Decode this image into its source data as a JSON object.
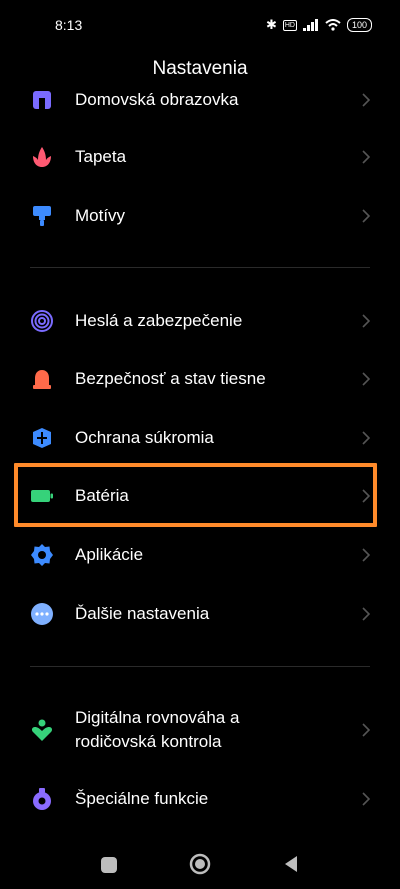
{
  "status": {
    "time": "8:13",
    "battery": "100",
    "network": "HD"
  },
  "page": {
    "title": "Nastavenia"
  },
  "items": [
    {
      "label": "Domovská obrazovka",
      "icon": "home-screen-icon",
      "color": "#7a6bff"
    },
    {
      "label": "Tapeta",
      "icon": "wallpaper-flower-icon",
      "color": "#ff5a73"
    },
    {
      "label": "Motívy",
      "icon": "themes-brush-icon",
      "color": "#3d8bff"
    },
    {
      "label": "Heslá a zabezpečenie",
      "icon": "fingerprint-icon",
      "color": "#7a6bff"
    },
    {
      "label": "Bezpečnosť a stav tiesne",
      "icon": "emergency-siren-icon",
      "color": "#ff6a4a"
    },
    {
      "label": "Ochrana súkromia",
      "icon": "privacy-shield-icon",
      "color": "#3d8bff"
    },
    {
      "label": "Batéria",
      "icon": "battery-icon",
      "color": "#36d27a"
    },
    {
      "label": "Aplikácie",
      "icon": "apps-gear-icon",
      "color": "#3d8bff"
    },
    {
      "label": "Ďalšie nastavenia",
      "icon": "more-dots-icon",
      "color": "#7fb0ff"
    },
    {
      "label": "Digitálna rovnováha a rodičovská kontrola",
      "icon": "digital-wellbeing-icon",
      "color": "#36d27a"
    },
    {
      "label": "Špeciálne funkcie",
      "icon": "special-features-icon",
      "color": "#8a6bff"
    }
  ],
  "highlight_color": "#ff8a2a"
}
